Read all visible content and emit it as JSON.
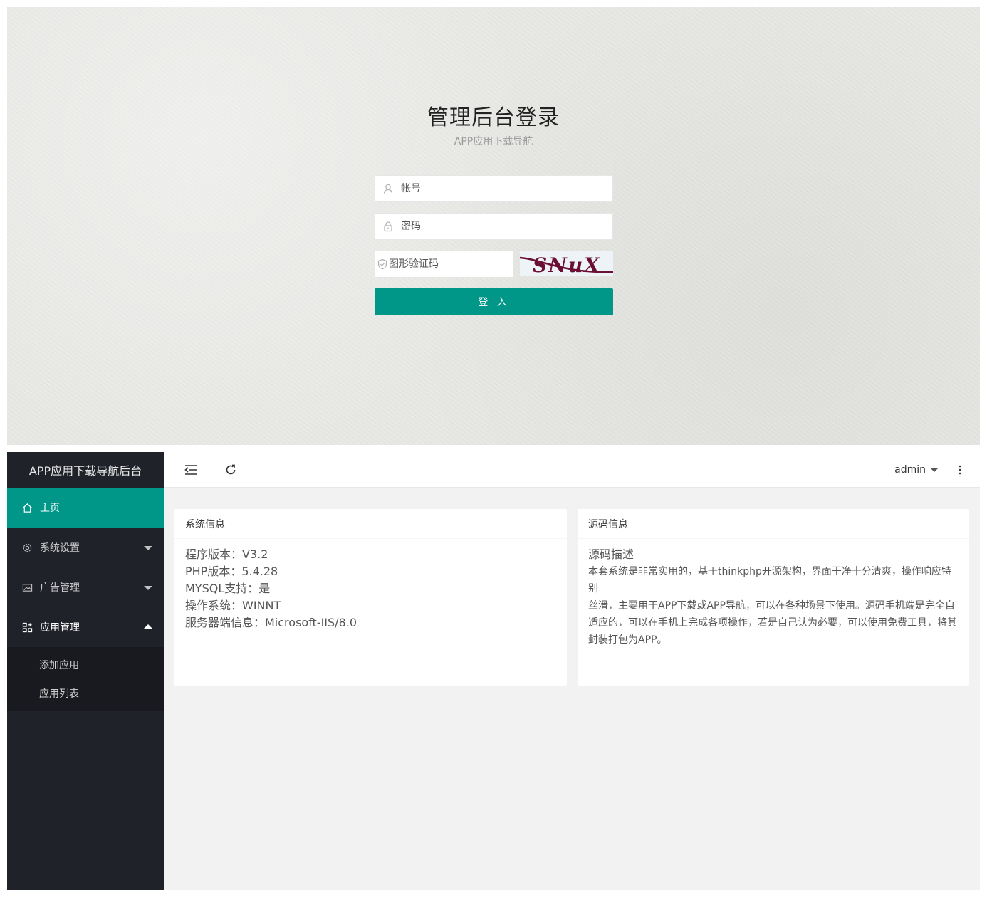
{
  "login": {
    "title": "管理后台登录",
    "subtitle": "APP应用下载导航",
    "username_placeholder": "帐号",
    "password_placeholder": "密码",
    "captcha_placeholder": "图形验证码",
    "captcha_text": "SNuX",
    "submit_label": "登 入"
  },
  "admin": {
    "logo": "APP应用下载导航后台",
    "nav": [
      {
        "label": "主页",
        "icon": "home-icon"
      },
      {
        "label": "系统设置",
        "icon": "gear-icon"
      },
      {
        "label": "广告管理",
        "icon": "image-icon"
      },
      {
        "label": "应用管理",
        "icon": "apps-icon"
      }
    ],
    "subnav": [
      {
        "label": "添加应用"
      },
      {
        "label": "应用列表"
      }
    ],
    "header": {
      "user": "admin"
    },
    "system_card": {
      "title": "系统信息",
      "lines": [
        "程序版本：V3.2",
        "PHP版本：5.4.28",
        "MYSQL支持：是",
        "操作系统：WINNT",
        "服务器端信息：Microsoft-IIS/8.0"
      ]
    },
    "source_card": {
      "title": "源码信息",
      "desc_title": "源码描述",
      "desc_lines": [
        "本套系统是非常实用的，基于thinkphp开源架构，界面干净十分清爽，操作响应特别",
        "丝滑，主要用于APP下载或APP导航，可以在各种场景下使用。源码手机端是完全自",
        "适应的，可以在手机上完成各项操作，若是自己认为必要，可以使用免费工具，将其",
        "封装打包为APP。"
      ]
    }
  },
  "colors": {
    "accent": "#009688",
    "sidebar": "#20222a",
    "subnav": "#181a1f"
  }
}
